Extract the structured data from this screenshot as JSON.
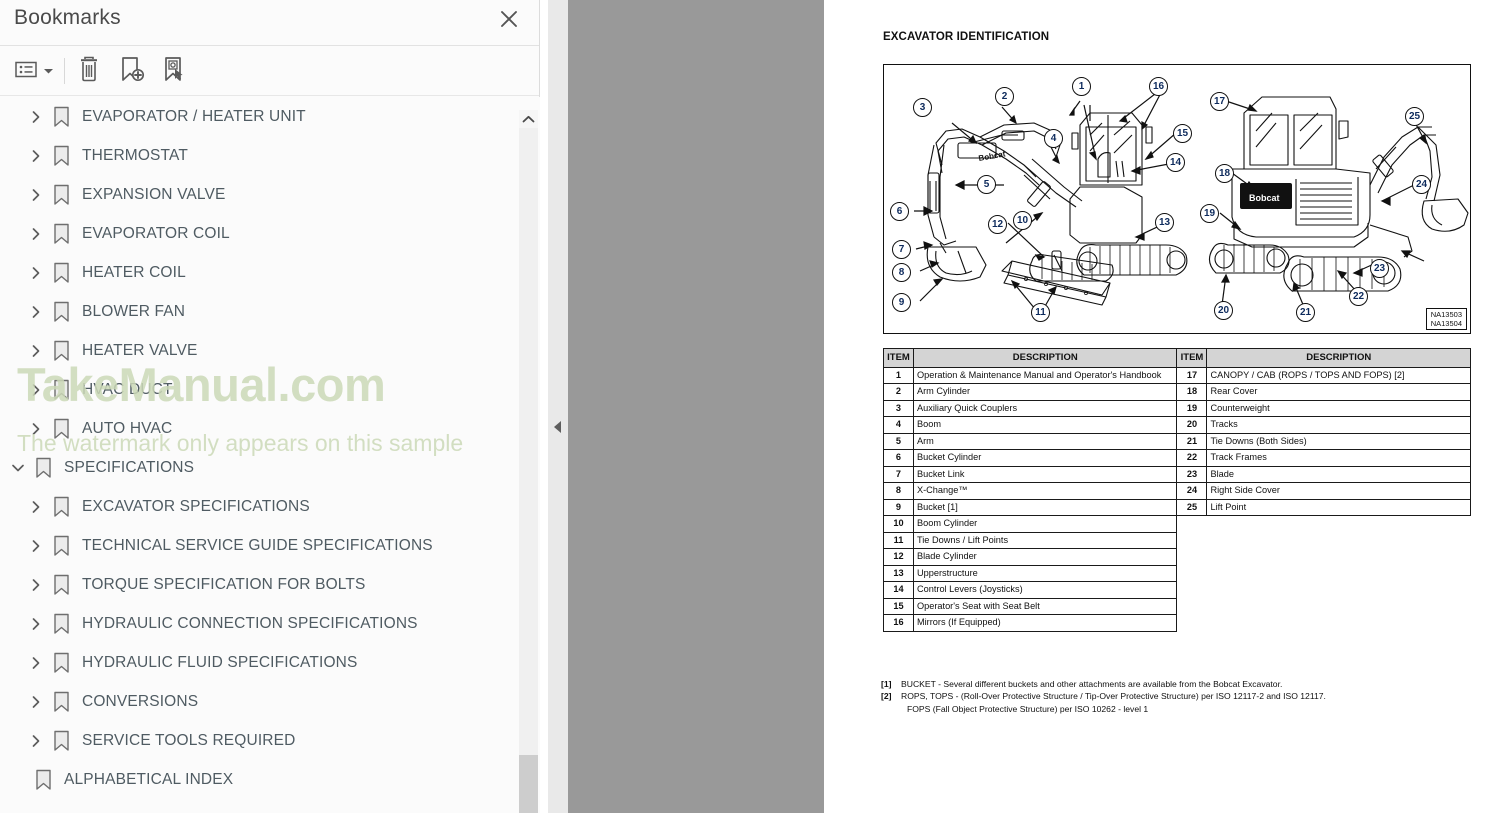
{
  "sidebar": {
    "title": "Bookmarks",
    "close_label": "Close",
    "toolbar": {
      "options_label": "Bookmark list options",
      "delete_label": "Delete bookmark",
      "add_label": "Add new bookmark",
      "select_label": "Select bookmark"
    },
    "items": [
      {
        "label": "EVAPORATOR / HEATER UNIT",
        "level": 1,
        "expandable": true,
        "expanded": false
      },
      {
        "label": "THERMOSTAT",
        "level": 1,
        "expandable": true,
        "expanded": false
      },
      {
        "label": "EXPANSION VALVE",
        "level": 1,
        "expandable": true,
        "expanded": false
      },
      {
        "label": "EVAPORATOR COIL",
        "level": 1,
        "expandable": true,
        "expanded": false
      },
      {
        "label": "HEATER COIL",
        "level": 1,
        "expandable": true,
        "expanded": false
      },
      {
        "label": "BLOWER FAN",
        "level": 1,
        "expandable": true,
        "expanded": false
      },
      {
        "label": "HEATER VALVE",
        "level": 1,
        "expandable": true,
        "expanded": false
      },
      {
        "label": "HVAC DUCT",
        "level": 1,
        "expandable": true,
        "expanded": false
      },
      {
        "label": "AUTO HVAC",
        "level": 1,
        "expandable": true,
        "expanded": false
      },
      {
        "label": "SPECIFICATIONS",
        "level": 0,
        "expandable": true,
        "expanded": true
      },
      {
        "label": "EXCAVATOR SPECIFICATIONS",
        "level": 1,
        "expandable": true,
        "expanded": false
      },
      {
        "label": "TECHNICAL SERVICE GUIDE SPECIFICATIONS",
        "level": 1,
        "expandable": true,
        "expanded": false
      },
      {
        "label": "TORQUE SPECIFICATION FOR BOLTS",
        "level": 1,
        "expandable": true,
        "expanded": false
      },
      {
        "label": "HYDRAULIC CONNECTION SPECIFICATIONS",
        "level": 1,
        "expandable": true,
        "expanded": false
      },
      {
        "label": "HYDRAULIC FLUID SPECIFICATIONS",
        "level": 1,
        "expandable": true,
        "expanded": false
      },
      {
        "label": "CONVERSIONS",
        "level": 1,
        "expandable": true,
        "expanded": false
      },
      {
        "label": "SERVICE TOOLS REQUIRED",
        "level": 1,
        "expandable": true,
        "expanded": false
      },
      {
        "label": "ALPHABETICAL INDEX",
        "level": 0,
        "expandable": false,
        "expanded": false
      }
    ]
  },
  "watermark": {
    "main": "TakeManual.com",
    "sub": "The watermark only appears on this sample"
  },
  "splitter": {
    "collapse_label": "Collapse panel"
  },
  "document": {
    "heading": "EXCAVATOR IDENTIFICATION",
    "figure": {
      "reference_line1": "NA13503",
      "reference_line2": "NA13504",
      "brand_text": "Bobcat",
      "callouts": [
        "1",
        "2",
        "3",
        "4",
        "5",
        "6",
        "7",
        "8",
        "9",
        "10",
        "11",
        "12",
        "13",
        "14",
        "15",
        "16",
        "17",
        "18",
        "19",
        "20",
        "21",
        "22",
        "23",
        "24",
        "25"
      ]
    },
    "table": {
      "headers": [
        "ITEM",
        "DESCRIPTION",
        "ITEM",
        "DESCRIPTION"
      ],
      "rows": [
        {
          "item_l": "1",
          "desc_l": "Operation & Maintenance Manual and Operator's Handbook",
          "item_r": "17",
          "desc_r": "CANOPY / CAB (ROPS / TOPS AND FOPS) [2]"
        },
        {
          "item_l": "2",
          "desc_l": "Arm Cylinder",
          "item_r": "18",
          "desc_r": "Rear Cover"
        },
        {
          "item_l": "3",
          "desc_l": "Auxiliary Quick Couplers",
          "item_r": "19",
          "desc_r": "Counterweight"
        },
        {
          "item_l": "4",
          "desc_l": "Boom",
          "item_r": "20",
          "desc_r": "Tracks"
        },
        {
          "item_l": "5",
          "desc_l": "Arm",
          "item_r": "21",
          "desc_r": "Tie Downs (Both Sides)"
        },
        {
          "item_l": "6",
          "desc_l": "Bucket Cylinder",
          "item_r": "22",
          "desc_r": "Track Frames"
        },
        {
          "item_l": "7",
          "desc_l": "Bucket Link",
          "item_r": "23",
          "desc_r": "Blade"
        },
        {
          "item_l": "8",
          "desc_l": "X-Change™",
          "item_r": "24",
          "desc_r": "Right Side Cover"
        },
        {
          "item_l": "9",
          "desc_l": "Bucket [1]",
          "item_r": "25",
          "desc_r": "Lift Point"
        },
        {
          "item_l": "10",
          "desc_l": "Boom Cylinder",
          "item_r": "",
          "desc_r": ""
        },
        {
          "item_l": "11",
          "desc_l": "Tie Downs / Lift Points",
          "item_r": "",
          "desc_r": ""
        },
        {
          "item_l": "12",
          "desc_l": "Blade Cylinder",
          "item_r": "",
          "desc_r": ""
        },
        {
          "item_l": "13",
          "desc_l": "Upperstructure",
          "item_r": "",
          "desc_r": ""
        },
        {
          "item_l": "14",
          "desc_l": "Control Levers (Joysticks)",
          "item_r": "",
          "desc_r": ""
        },
        {
          "item_l": "15",
          "desc_l": "Operator's Seat with Seat Belt",
          "item_r": "",
          "desc_r": ""
        },
        {
          "item_l": "16",
          "desc_l": "Mirrors (If Equipped)",
          "item_r": "",
          "desc_r": ""
        }
      ]
    },
    "footnotes": [
      {
        "mark": "[1]",
        "text": "BUCKET - Several different buckets and other attachments are available from the Bobcat Excavator.",
        "cont": ""
      },
      {
        "mark": "[2]",
        "text": "ROPS, TOPS - (Roll-Over Protective Structure / Tip-Over Protective Structure) per ISO 12117-2 and ISO 12117.",
        "cont": "FOPS (Fall Object Protective Structure) per ISO 10262 - level 1"
      }
    ]
  },
  "colors": {
    "panel_bg": "#fbfbfb",
    "doc_backdrop": "#999999",
    "splitter": "#e9e9e9",
    "label_text": "#4f5b62",
    "watermark": "#ccd9b8",
    "table_header": "#d4d4d4",
    "callout_text": "#0d2a5c"
  }
}
